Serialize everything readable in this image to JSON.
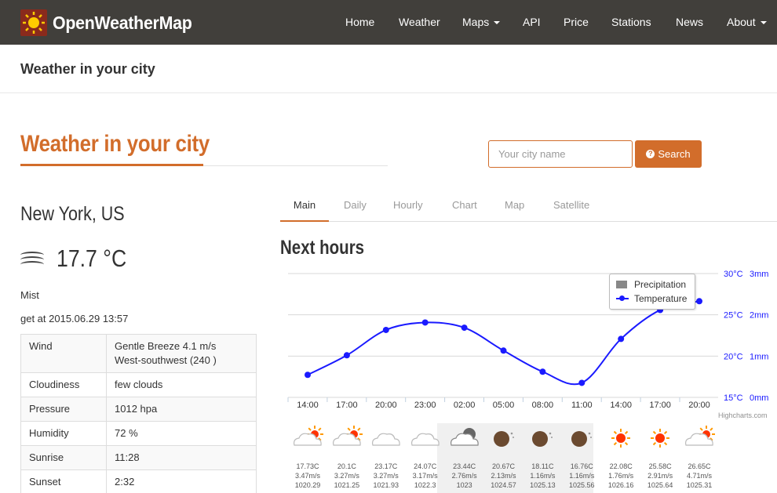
{
  "nav": {
    "brand": "OpenWeatherMap",
    "items": [
      {
        "label": "Home",
        "dropdown": false
      },
      {
        "label": "Weather",
        "dropdown": false
      },
      {
        "label": "Maps",
        "dropdown": true
      },
      {
        "label": "API",
        "dropdown": false
      },
      {
        "label": "Price",
        "dropdown": false
      },
      {
        "label": "Stations",
        "dropdown": false
      },
      {
        "label": "News",
        "dropdown": false
      },
      {
        "label": "About",
        "dropdown": true
      }
    ]
  },
  "header": {
    "title": "Weather in your city"
  },
  "main": {
    "title": "Weather in your city"
  },
  "search": {
    "placeholder": "Your city name",
    "button": "Search"
  },
  "current": {
    "city": "New York, US",
    "temperature": "17.7 °C",
    "icon": "mist-icon",
    "description": "Mist",
    "get_at": "get at 2015.06.29 13:57",
    "table": [
      {
        "label": "Wind",
        "value": "Gentle Breeze 4.1 m/s",
        "value2": "West-southwest (240 )"
      },
      {
        "label": "Cloudiness",
        "value": "few clouds"
      },
      {
        "label": "Pressure",
        "value": "1012 hpa"
      },
      {
        "label": "Humidity",
        "value": "72 %"
      },
      {
        "label": "Sunrise",
        "value": "11:28"
      },
      {
        "label": "Sunset",
        "value": "2:32"
      }
    ]
  },
  "tabs": [
    "Main",
    "Daily",
    "Hourly",
    "Chart",
    "Map",
    "Satellite"
  ],
  "section_title": "Next hours",
  "chart_data": {
    "type": "line",
    "categories": [
      "14:00",
      "17:00",
      "20:00",
      "23:00",
      "02:00",
      "05:00",
      "08:00",
      "11:00",
      "14:00",
      "17:00",
      "20:00"
    ],
    "series": [
      {
        "name": "Temperature",
        "unit": "°C",
        "values": [
          17.73,
          20.1,
          23.17,
          24.07,
          23.44,
          20.67,
          18.11,
          16.76,
          22.08,
          25.58,
          26.65
        ]
      },
      {
        "name": "Precipitation",
        "unit": "mm",
        "values": [
          0,
          0,
          0,
          0,
          0,
          0,
          0,
          0,
          0,
          0,
          0
        ]
      }
    ],
    "y_left_ticks": [
      "15°C",
      "20°C",
      "25°C",
      "30°C"
    ],
    "y_right_ticks": [
      "0mm",
      "1mm",
      "2mm",
      "3mm"
    ],
    "ylim": [
      15,
      30
    ],
    "legend_position": "top-right",
    "credit": "Highcharts.com",
    "color": "#1a1aff"
  },
  "forecast": [
    {
      "icon": "cloud-sun-icon",
      "temp": "17.73C",
      "wind": "3.47m/s",
      "pressure": "1020.29"
    },
    {
      "icon": "cloud-sun-icon",
      "temp": "20.1C",
      "wind": "3.27m/s",
      "pressure": "1021.25"
    },
    {
      "icon": "cloud-icon",
      "temp": "23.17C",
      "wind": "3.27m/s",
      "pressure": "1021.93"
    },
    {
      "icon": "cloud-icon",
      "temp": "24.07C",
      "wind": "3.17m/s",
      "pressure": "1022.3"
    },
    {
      "icon": "cloud-moon-icon",
      "temp": "23.44C",
      "wind": "2.76m/s",
      "pressure": "1023"
    },
    {
      "icon": "moon-icon",
      "temp": "20.67C",
      "wind": "2.13m/s",
      "pressure": "1024.57"
    },
    {
      "icon": "moon-icon",
      "temp": "18.11C",
      "wind": "1.16m/s",
      "pressure": "1025.13"
    },
    {
      "icon": "moon-icon",
      "temp": "16.76C",
      "wind": "1.16m/s",
      "pressure": "1025.56"
    },
    {
      "icon": "sun-icon",
      "temp": "22.08C",
      "wind": "1.76m/s",
      "pressure": "1026.16"
    },
    {
      "icon": "sun-icon",
      "temp": "25.58C",
      "wind": "2.91m/s",
      "pressure": "1025.64"
    },
    {
      "icon": "cloud-sun-icon",
      "temp": "26.65C",
      "wind": "4.71m/s",
      "pressure": "1025.31"
    }
  ],
  "colors": {
    "navbar": "#413f3b",
    "accent": "#d26d2b",
    "series": "#1a1aff"
  }
}
